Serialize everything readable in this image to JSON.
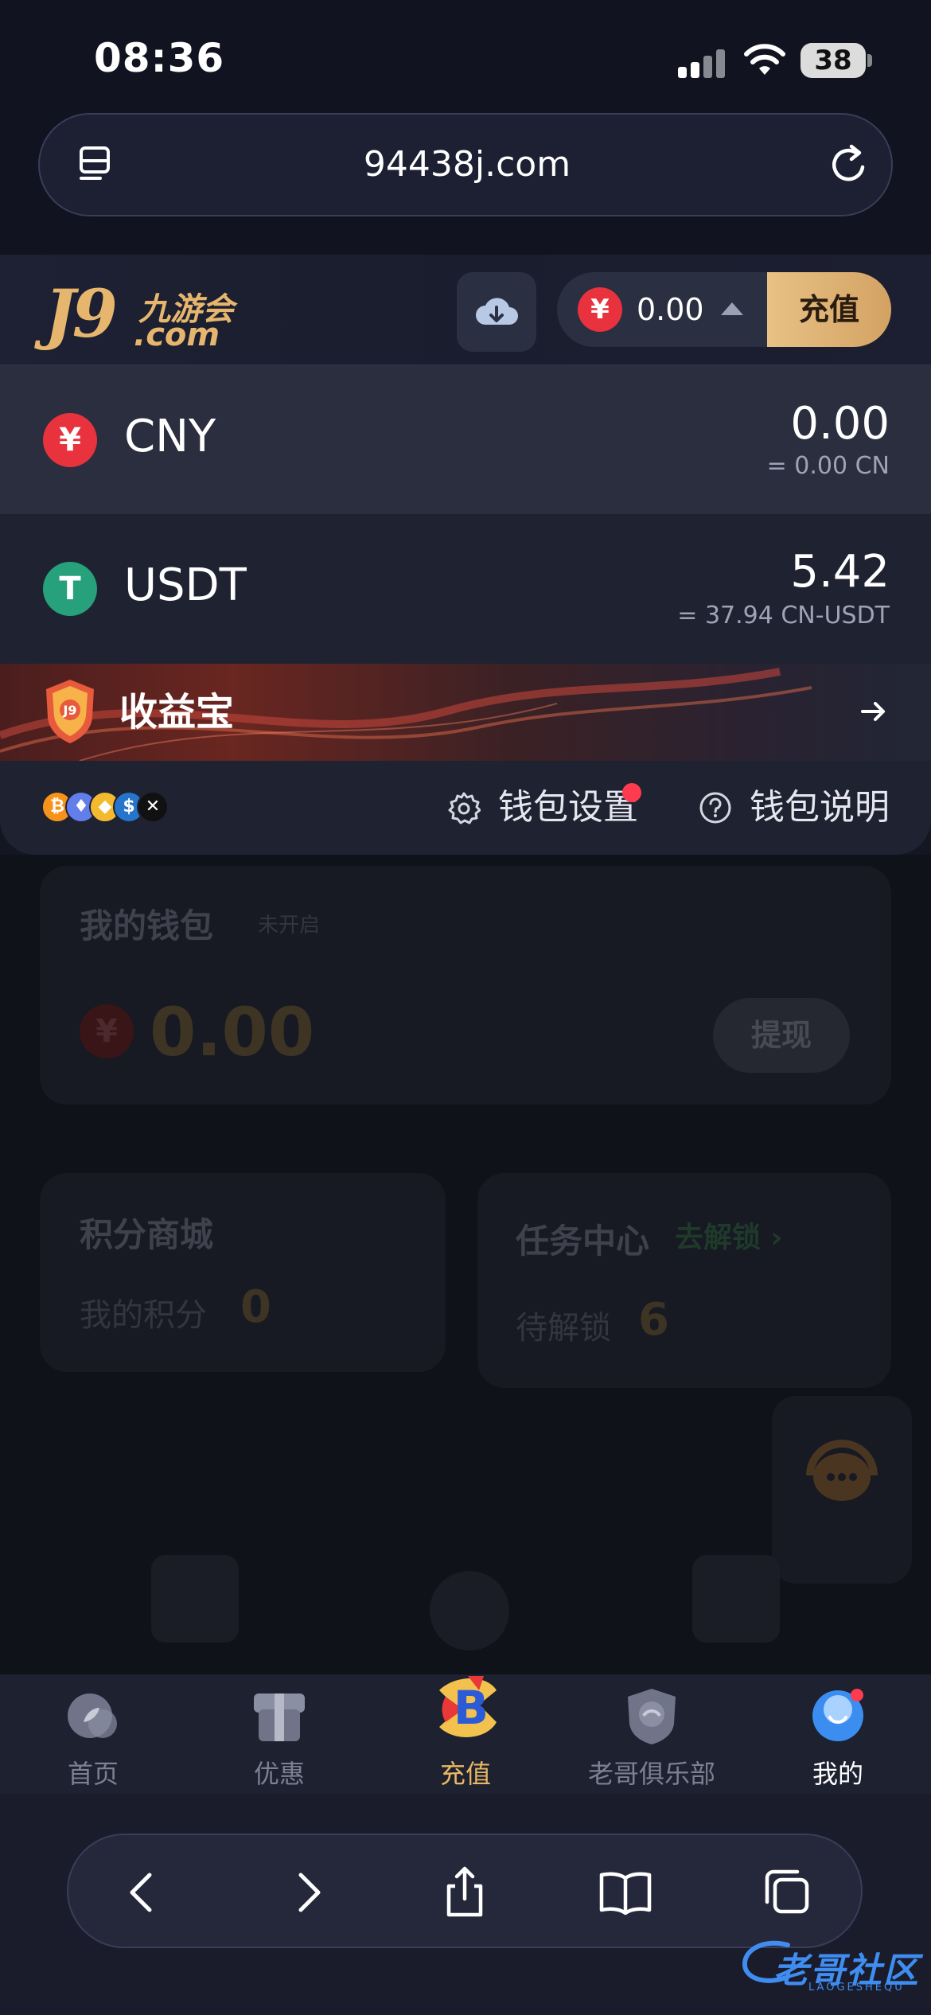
{
  "status_bar": {
    "time": "08:36",
    "battery": "38"
  },
  "browser": {
    "url": "94438j.com"
  },
  "header": {
    "logo_main": "J9",
    "logo_cn": "九游会",
    "logo_com": ".com",
    "balance_currency_symbol": "¥",
    "balance_amount": "0.00",
    "recharge_label": "充值"
  },
  "wallet_panel": {
    "currencies": [
      {
        "symbol": "¥",
        "name": "CNY",
        "amount": "0.00",
        "sub": "= 0.00 CN",
        "color": "#e8323d"
      },
      {
        "symbol": "T",
        "name": "USDT",
        "amount": "5.42",
        "sub": "= 37.94 CN-USDT",
        "color": "#26a17b"
      }
    ],
    "banner_label": "收益宝",
    "mini_coins": [
      {
        "symbol": "₿",
        "color": "#f7931a"
      },
      {
        "symbol": "♦",
        "color": "#627eea"
      },
      {
        "symbol": "◆",
        "color": "#f3ba2f"
      },
      {
        "symbol": "$",
        "color": "#2775ca"
      },
      {
        "symbol": "✕",
        "color": "#111111"
      }
    ],
    "settings_label": "钱包设置",
    "help_label": "钱包说明"
  },
  "background_page": {
    "wallet_title": "我的钱包",
    "wallet_status": "未开启",
    "wallet_symbol": "¥",
    "wallet_amount": "0.00",
    "withdraw_label": "提现",
    "points_title": "积分商城",
    "points_label": "我的积分",
    "points_value": "0",
    "tasks_title": "任务中心",
    "tasks_unlock": "去解锁 ›",
    "tasks_label": "待解锁",
    "tasks_value": "6"
  },
  "tab_bar": {
    "tabs": [
      {
        "label": "首页",
        "icon": "home-icon"
      },
      {
        "label": "优惠",
        "icon": "gift-icon"
      },
      {
        "label": "充值",
        "icon": "recharge-icon"
      },
      {
        "label": "老哥俱乐部",
        "icon": "club-icon"
      },
      {
        "label": "我的",
        "icon": "profile-icon"
      }
    ]
  },
  "watermark": {
    "text": "老哥社区",
    "sub": "LAOGESHEQU"
  },
  "colors": {
    "accent_gold": "#e8b864",
    "brand_red": "#e8323d",
    "usdt_green": "#26a17b",
    "notify_red": "#ff3b4f"
  }
}
